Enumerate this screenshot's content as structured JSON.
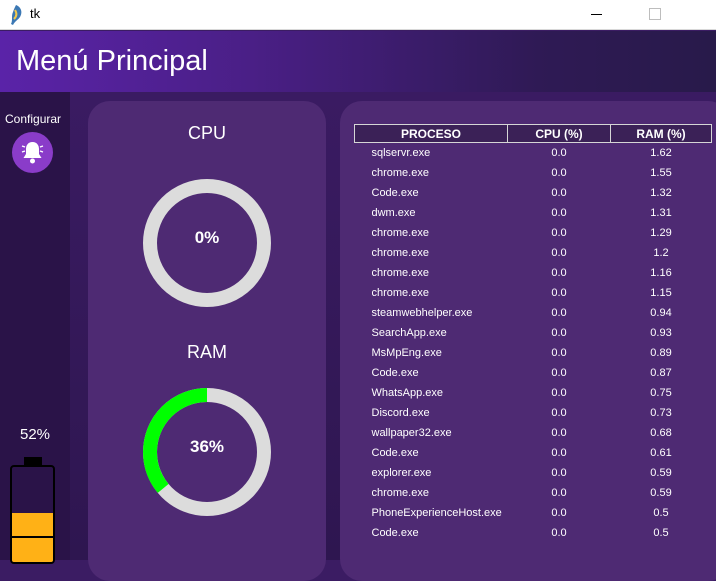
{
  "window": {
    "title": "tk"
  },
  "header": {
    "title": "Menú Principal"
  },
  "sidebar": {
    "config_label": "Configurar",
    "battery": {
      "percent_label": "52%",
      "level": 0.52,
      "fill_color": "#ffb116"
    }
  },
  "gauges": {
    "cpu": {
      "title": "CPU",
      "value_label": "0%",
      "value": 0
    },
    "ram": {
      "title": "RAM",
      "value_label": "36%",
      "value": 0.36
    },
    "colors": {
      "track": "#dcdcdc",
      "fill": "#00ff00"
    }
  },
  "table": {
    "headers": {
      "process": "PROCESO",
      "cpu": "CPU (%)",
      "ram": "RAM (%)"
    },
    "rows": [
      {
        "name": "sqlservr.exe",
        "cpu": "0.0",
        "ram": "1.62"
      },
      {
        "name": "chrome.exe",
        "cpu": "0.0",
        "ram": "1.55"
      },
      {
        "name": "Code.exe",
        "cpu": "0.0",
        "ram": "1.32"
      },
      {
        "name": "dwm.exe",
        "cpu": "0.0",
        "ram": "1.31"
      },
      {
        "name": "chrome.exe",
        "cpu": "0.0",
        "ram": "1.29"
      },
      {
        "name": "chrome.exe",
        "cpu": "0.0",
        "ram": "1.2"
      },
      {
        "name": "chrome.exe",
        "cpu": "0.0",
        "ram": "1.16"
      },
      {
        "name": "chrome.exe",
        "cpu": "0.0",
        "ram": "1.15"
      },
      {
        "name": "steamwebhelper.exe",
        "cpu": "0.0",
        "ram": "0.94"
      },
      {
        "name": "SearchApp.exe",
        "cpu": "0.0",
        "ram": "0.93"
      },
      {
        "name": "MsMpEng.exe",
        "cpu": "0.0",
        "ram": "0.89"
      },
      {
        "name": "Code.exe",
        "cpu": "0.0",
        "ram": "0.87"
      },
      {
        "name": "WhatsApp.exe",
        "cpu": "0.0",
        "ram": "0.75"
      },
      {
        "name": "Discord.exe",
        "cpu": "0.0",
        "ram": "0.73"
      },
      {
        "name": "wallpaper32.exe",
        "cpu": "0.0",
        "ram": "0.68"
      },
      {
        "name": "Code.exe",
        "cpu": "0.0",
        "ram": "0.61"
      },
      {
        "name": "explorer.exe",
        "cpu": "0.0",
        "ram": "0.59"
      },
      {
        "name": "chrome.exe",
        "cpu": "0.0",
        "ram": "0.59"
      },
      {
        "name": "PhoneExperienceHost.exe",
        "cpu": "0.0",
        "ram": "0.5"
      },
      {
        "name": "Code.exe",
        "cpu": "0.0",
        "ram": "0.5"
      }
    ]
  }
}
